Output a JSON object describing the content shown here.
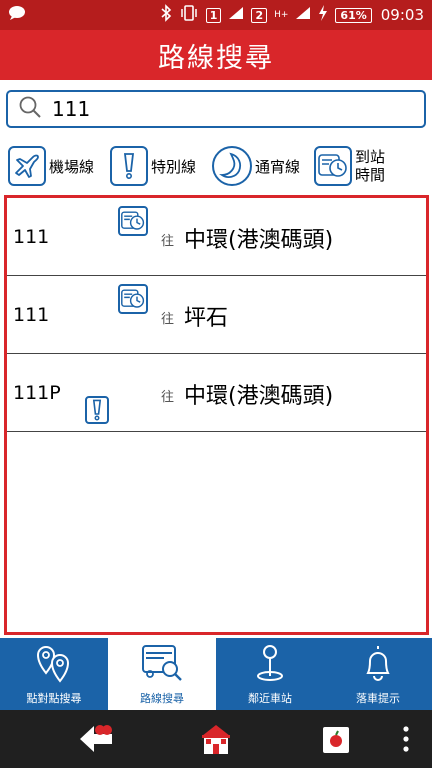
{
  "status": {
    "sim1": "1",
    "sim2": "2",
    "network": "H+",
    "battery": "61%",
    "time": "09:03"
  },
  "header": {
    "title": "路線搜尋"
  },
  "search": {
    "value": "111",
    "placeholder": ""
  },
  "filters": [
    {
      "label": "機場線",
      "icon": "airplane-icon"
    },
    {
      "label": "特別線",
      "icon": "exclamation-icon"
    },
    {
      "label": "通宵線",
      "icon": "moon-icon"
    },
    {
      "label_line1": "到站",
      "label_line2": "時間",
      "icon": "bus-clock-icon"
    }
  ],
  "routes": [
    {
      "number": "111",
      "to_label": "往",
      "destination": "中環(港澳碼頭)",
      "icon": "bus-clock-icon"
    },
    {
      "number": "111",
      "to_label": "往",
      "destination": "坪石",
      "icon": "bus-clock-icon"
    },
    {
      "number": "111P",
      "to_label": "往",
      "destination": "中環(港澳碼頭)",
      "icon": "exclamation-icon"
    }
  ],
  "bottom_nav": [
    {
      "label": "點對點搜尋",
      "icon": "location-pins-icon",
      "active": false
    },
    {
      "label": "路線搜尋",
      "icon": "bus-search-icon",
      "active": true
    },
    {
      "label": "鄰近車站",
      "icon": "map-pin-icon",
      "active": false
    },
    {
      "label": "落車提示",
      "icon": "bell-icon",
      "active": false
    }
  ],
  "colors": {
    "brand_red": "#d9262a",
    "status_red": "#b51d1d",
    "accent_blue": "#1b63a8"
  }
}
